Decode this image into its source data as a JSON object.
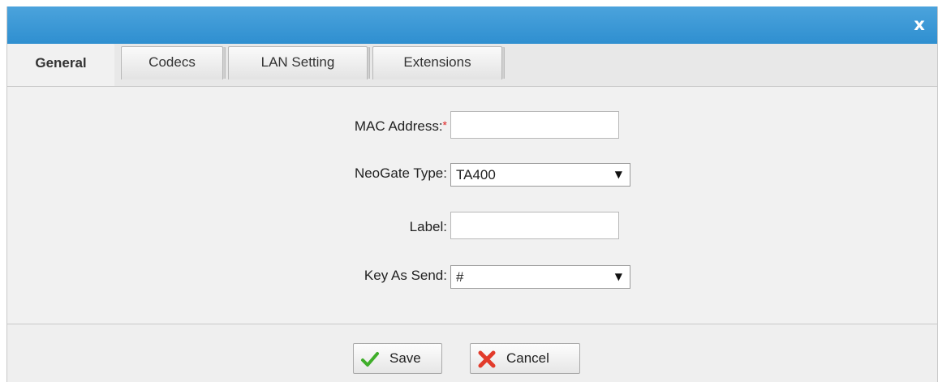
{
  "dialog": {
    "close_label": "x"
  },
  "tabs": [
    {
      "label": "General",
      "active": true
    },
    {
      "label": "Codecs",
      "active": false
    },
    {
      "label": "LAN Setting",
      "active": false
    },
    {
      "label": "Extensions",
      "active": false
    }
  ],
  "form": {
    "mac_address": {
      "label": "MAC Address:",
      "required_mark": "*",
      "value": ""
    },
    "neogate_type": {
      "label": "NeoGate Type:",
      "value": "TA400"
    },
    "label_field": {
      "label": "Label:",
      "value": ""
    },
    "key_as_send": {
      "label": "Key As Send:",
      "value": "#"
    }
  },
  "buttons": {
    "save": {
      "label": "Save",
      "icon": "check-icon"
    },
    "cancel": {
      "label": "Cancel",
      "icon": "x-icon"
    }
  },
  "colors": {
    "titlebar": "#3a97d6",
    "required": "#e02020",
    "check": "#3fae2a",
    "cancel": "#e23b2b"
  }
}
